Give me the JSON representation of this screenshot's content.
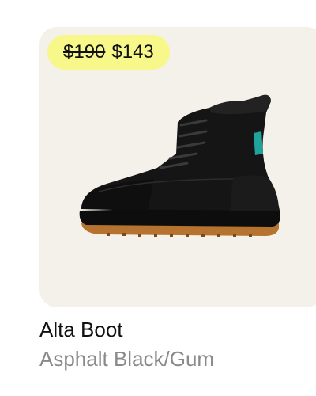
{
  "product": {
    "name": "Alta Boot",
    "color": "Asphalt Black/Gum",
    "price": {
      "original": "$190",
      "sale": "$143"
    },
    "image_icon": "boot-icon"
  },
  "colors": {
    "panel_bg": "#f3f1ea",
    "badge_bg": "#f8f78a",
    "name_text": "#111111",
    "color_text": "#8a8a8a",
    "boot_body": "#151515",
    "boot_accent": "#1fa39a",
    "sole_gum": "#b5732f"
  }
}
